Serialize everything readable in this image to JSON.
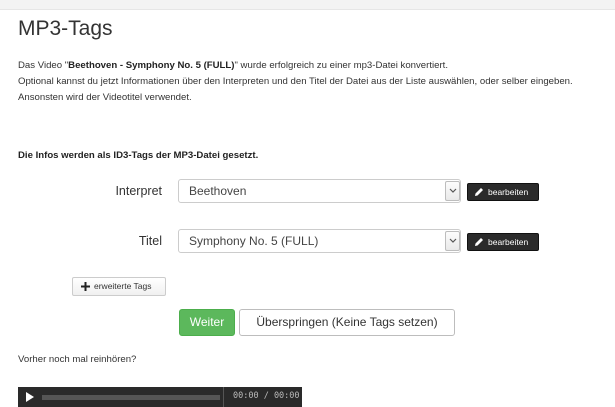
{
  "page": {
    "title": "MP3-Tags",
    "intro": {
      "prefix": "Das Video \"",
      "video_title": "Beethoven - Symphony No. 5 (FULL)",
      "suffix": "\" wurde erfolgreich zu einer mp3-Datei konvertiert.",
      "line2": "Optional kannst du jetzt Informationen über den Interpreten und den Titel der Datei aus der Liste auswählen, oder selber eingeben.",
      "line3": "Ansonsten wird der Videotitel verwendet."
    },
    "id3_notice": "Die Infos werden als ID3-Tags der MP3-Datei gesetzt."
  },
  "form": {
    "interpret": {
      "label": "Interpret",
      "value": "Beethoven",
      "edit_label": "bearbeiten"
    },
    "titel": {
      "label": "Titel",
      "value": "Symphony No. 5 (FULL)",
      "edit_label": "bearbeiten"
    },
    "advanced_tags_label": "erweiterte Tags",
    "next_label": "Weiter",
    "skip_label": "Überspringen (Keine Tags setzen)"
  },
  "preview": {
    "label": "Vorher noch mal reinhören?",
    "time": "00:00 / 00:00"
  },
  "colors": {
    "primary_green": "#5cb85c",
    "dark_button": "#2b2b2b",
    "player_bg": "#2a2a2a"
  },
  "icons": {
    "edit": "pencil-icon",
    "add": "plus-icon",
    "caret": "chevron-down-icon",
    "play": "play-icon"
  }
}
